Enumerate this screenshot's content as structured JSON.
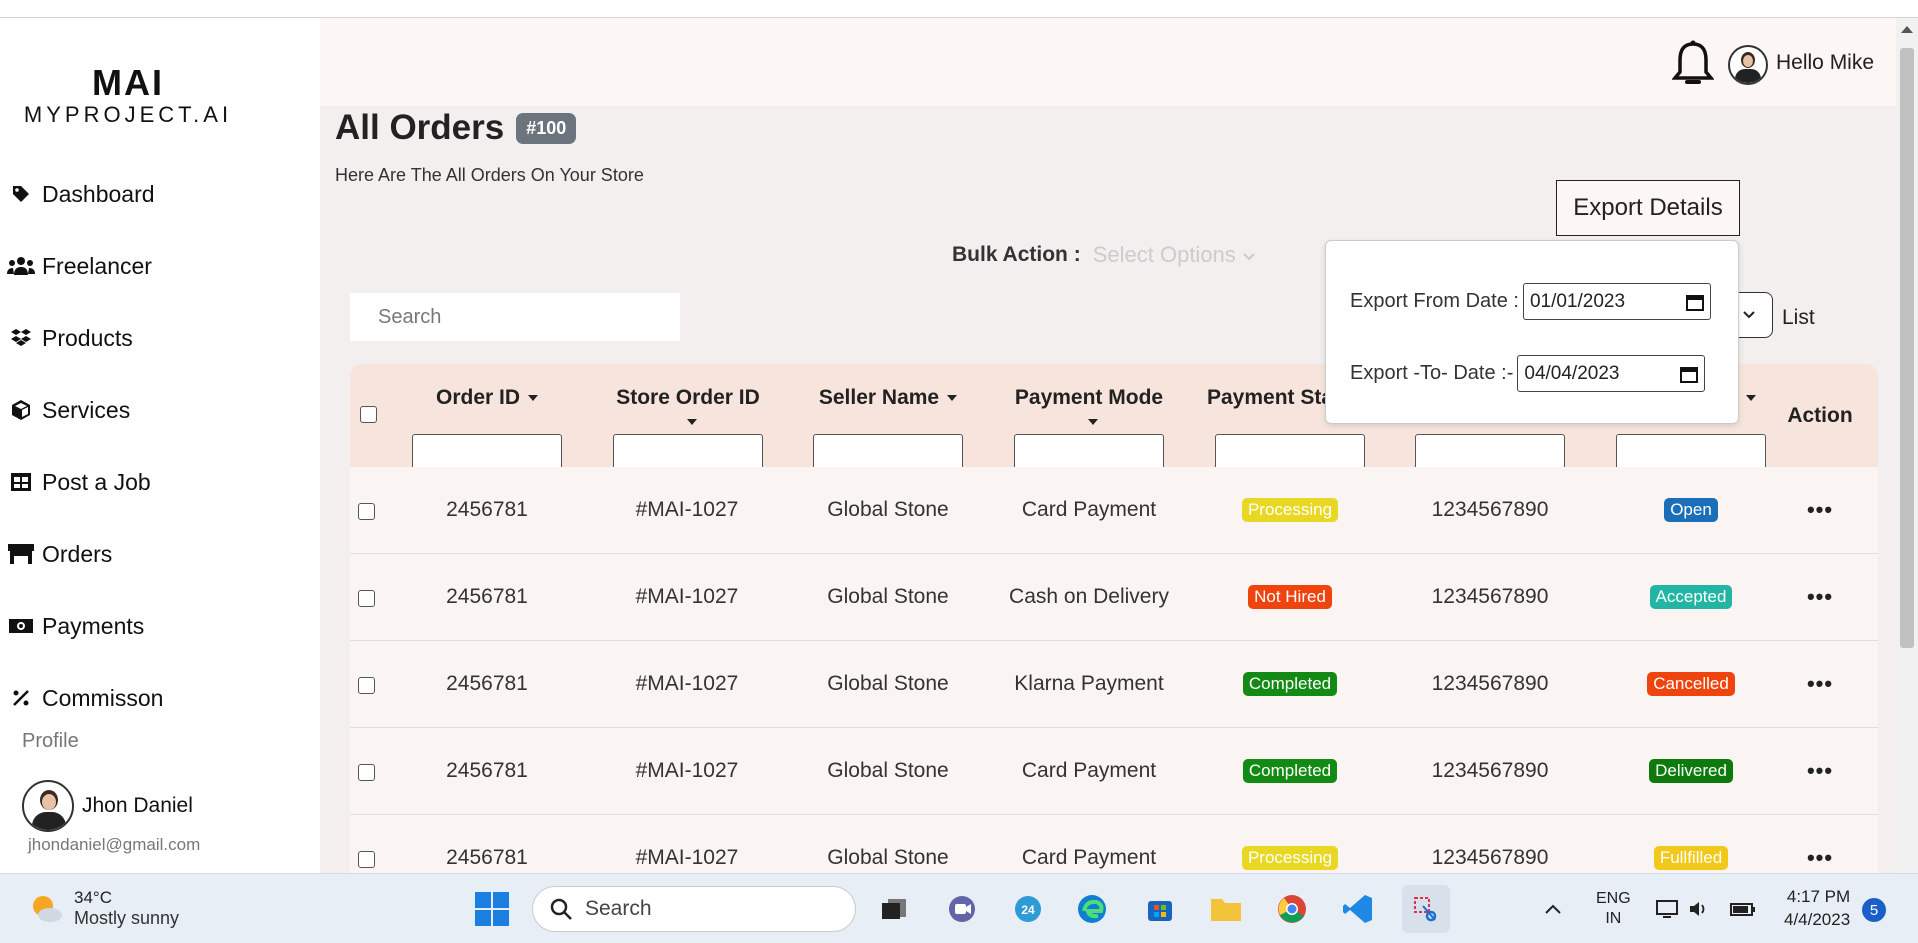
{
  "logo": {
    "mark": "MAI",
    "text": "MYPROJECT.AI"
  },
  "sidebar": {
    "items": [
      {
        "label": "Dashboard",
        "icon": "tag-icon"
      },
      {
        "label": "Freelancer",
        "icon": "users-icon"
      },
      {
        "label": "Products",
        "icon": "dropbox-icon"
      },
      {
        "label": "Services",
        "icon": "cube-icon"
      },
      {
        "label": "Post a Job",
        "icon": "table-icon"
      },
      {
        "label": "Orders",
        "icon": "store-icon"
      },
      {
        "label": "Payments",
        "icon": "money-icon"
      },
      {
        "label": "Commisson",
        "icon": "percent-icon"
      }
    ],
    "profile_label": "Profile",
    "profile_name": "Jhon Daniel",
    "profile_email": "jhondaniel@gmail.com"
  },
  "header": {
    "greeting": "Hello Mike"
  },
  "page": {
    "title": "All Orders",
    "count_badge": "#100",
    "subtitle": "Here Are The All Orders On Your Store",
    "export_button": "Export Details",
    "bulk_label": "Bulk Action :",
    "bulk_placeholder": "Select Options",
    "search_placeholder": "Search",
    "view_label": "List"
  },
  "export_popup": {
    "from_label": "Export From Date :",
    "from_value": "01/01/2023",
    "to_label": "Export -To- Date :-",
    "to_value": "04/04/2023"
  },
  "table": {
    "headers": [
      "Order ID",
      "Store Order ID",
      "Seller Name",
      "Payment Mode",
      "Payment Sta",
      "",
      "",
      "Action"
    ],
    "rows": [
      {
        "order_id": "2456781",
        "store_order_id": "#MAI-1027",
        "seller": "Global Stone",
        "payment_mode": "Card Payment",
        "payment_status": "Processing",
        "phone": "1234567890",
        "order_status": "Open"
      },
      {
        "order_id": "2456781",
        "store_order_id": "#MAI-1027",
        "seller": "Global Stone",
        "payment_mode": "Cash on Delivery",
        "payment_status": "Not Hired",
        "phone": "1234567890",
        "order_status": "Accepted"
      },
      {
        "order_id": "2456781",
        "store_order_id": "#MAI-1027",
        "seller": "Global Stone",
        "payment_mode": "Klarna Payment",
        "payment_status": "Completed",
        "phone": "1234567890",
        "order_status": "Cancelled"
      },
      {
        "order_id": "2456781",
        "store_order_id": "#MAI-1027",
        "seller": "Global Stone",
        "payment_mode": "Card Payment",
        "payment_status": "Completed",
        "phone": "1234567890",
        "order_status": "Delivered"
      },
      {
        "order_id": "2456781",
        "store_order_id": "#MAI-1027",
        "seller": "Global Stone",
        "payment_mode": "Card Payment",
        "payment_status": "Processing",
        "phone": "1234567890",
        "order_status": "Fullfilled"
      }
    ],
    "action_glyph": "•••"
  },
  "status_colors": {
    "Processing": "#e8d824",
    "Not Hired": "#f0440f",
    "Completed": "#138a13",
    "Open": "#1b6fb8",
    "Accepted": "#22b5a4",
    "Cancelled": "#f0440f",
    "Delivered": "#0d7a0d",
    "Fullfilled": "#f2c81b"
  },
  "taskbar": {
    "weather_temp": "34°C",
    "weather_desc": "Mostly sunny",
    "search_text": "Search",
    "lang_top": "ENG",
    "lang_bottom": "IN",
    "time": "4:17 PM",
    "date": "4/4/2023",
    "notifications": "5"
  }
}
